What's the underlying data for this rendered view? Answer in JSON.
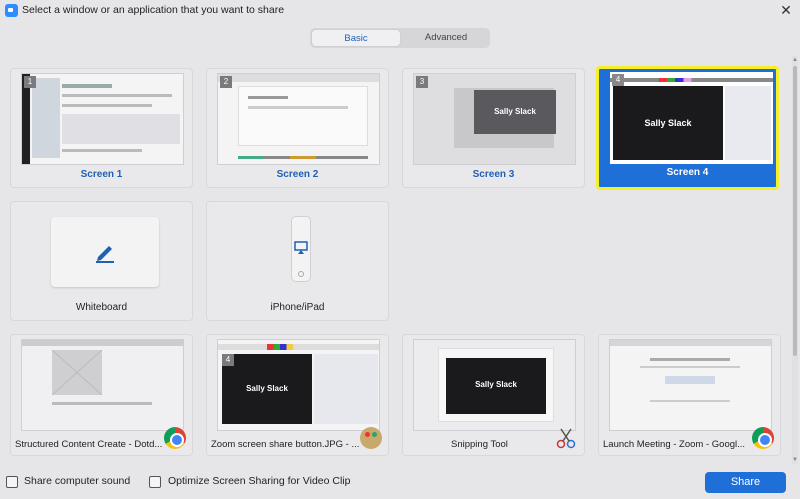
{
  "window": {
    "title": "Select a window or an application that you want to share",
    "close_glyph": "✕"
  },
  "tabs": [
    {
      "label": "Basic",
      "active": true
    },
    {
      "label": "Advanced",
      "active": false
    }
  ],
  "screens": [
    {
      "label": "Screen 1",
      "number": "1",
      "selected": false
    },
    {
      "label": "Screen 2",
      "number": "2",
      "selected": false
    },
    {
      "label": "Screen 3",
      "number": "3",
      "selected": false,
      "thumb_text": "Sally Slack"
    },
    {
      "label": "Screen 4",
      "number": "4",
      "selected": true,
      "thumb_text": "Sally Slack"
    }
  ],
  "sources": [
    {
      "label": "Whiteboard",
      "icon": "pencil-icon"
    },
    {
      "label": "iPhone/iPad",
      "icon": "airplay-icon"
    }
  ],
  "windows": [
    {
      "label": "Structured Content Create - Dotd...",
      "icon": "chrome-icon"
    },
    {
      "label": "Zoom screen share button.JPG - ...",
      "icon": "paint-icon",
      "number": "4",
      "thumb_text": "Sally Slack"
    },
    {
      "label": "Snipping Tool",
      "icon": "snipping-tool-icon",
      "thumb_text": "Sally Slack"
    },
    {
      "label": "Launch Meeting - Zoom - Googl...",
      "icon": "chrome-icon"
    }
  ],
  "options": {
    "share_sound": "Share computer sound",
    "optimize_video": "Optimize Screen Sharing for Video Clip"
  },
  "share_button": "Share",
  "colors": {
    "accent": "#1f6fd8",
    "selection_border": "#f5ee2a",
    "label_blue": "#1f5fb5"
  }
}
